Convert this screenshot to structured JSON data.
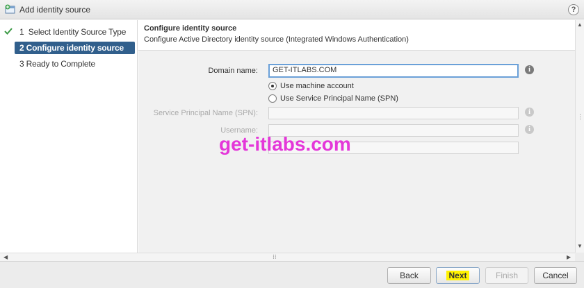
{
  "window": {
    "title": "Add identity source",
    "help_glyph": "?"
  },
  "steps": [
    {
      "number": "1",
      "label": "Select Identity Source Type",
      "state": "completed"
    },
    {
      "number": "2",
      "label": "Configure identity source",
      "state": "active"
    },
    {
      "number": "3",
      "label": "Ready to Complete",
      "state": "pending"
    }
  ],
  "section": {
    "title": "Configure identity source",
    "subtitle": "Configure Active Directory identity source (Integrated Windows Authentication)"
  },
  "form": {
    "domain_label": "Domain name:",
    "domain_value": "GET-ITLABS.COM",
    "radio_machine": "Use machine account",
    "radio_spn": "Use Service Principal Name (SPN)",
    "selected_radio": "machine",
    "spn_label": "Service Principal Name (SPN):",
    "spn_value": "",
    "username_label": "Username:",
    "username_value": "",
    "password_value": ""
  },
  "watermark": "get-itlabs.com",
  "footer": {
    "back": "Back",
    "next": "Next",
    "finish": "Finish",
    "cancel": "Cancel"
  },
  "colors": {
    "active_step": "#315f8c",
    "next_highlight": "#fff200",
    "watermark": "#e437d9",
    "focus_border": "#6aa0d8"
  }
}
